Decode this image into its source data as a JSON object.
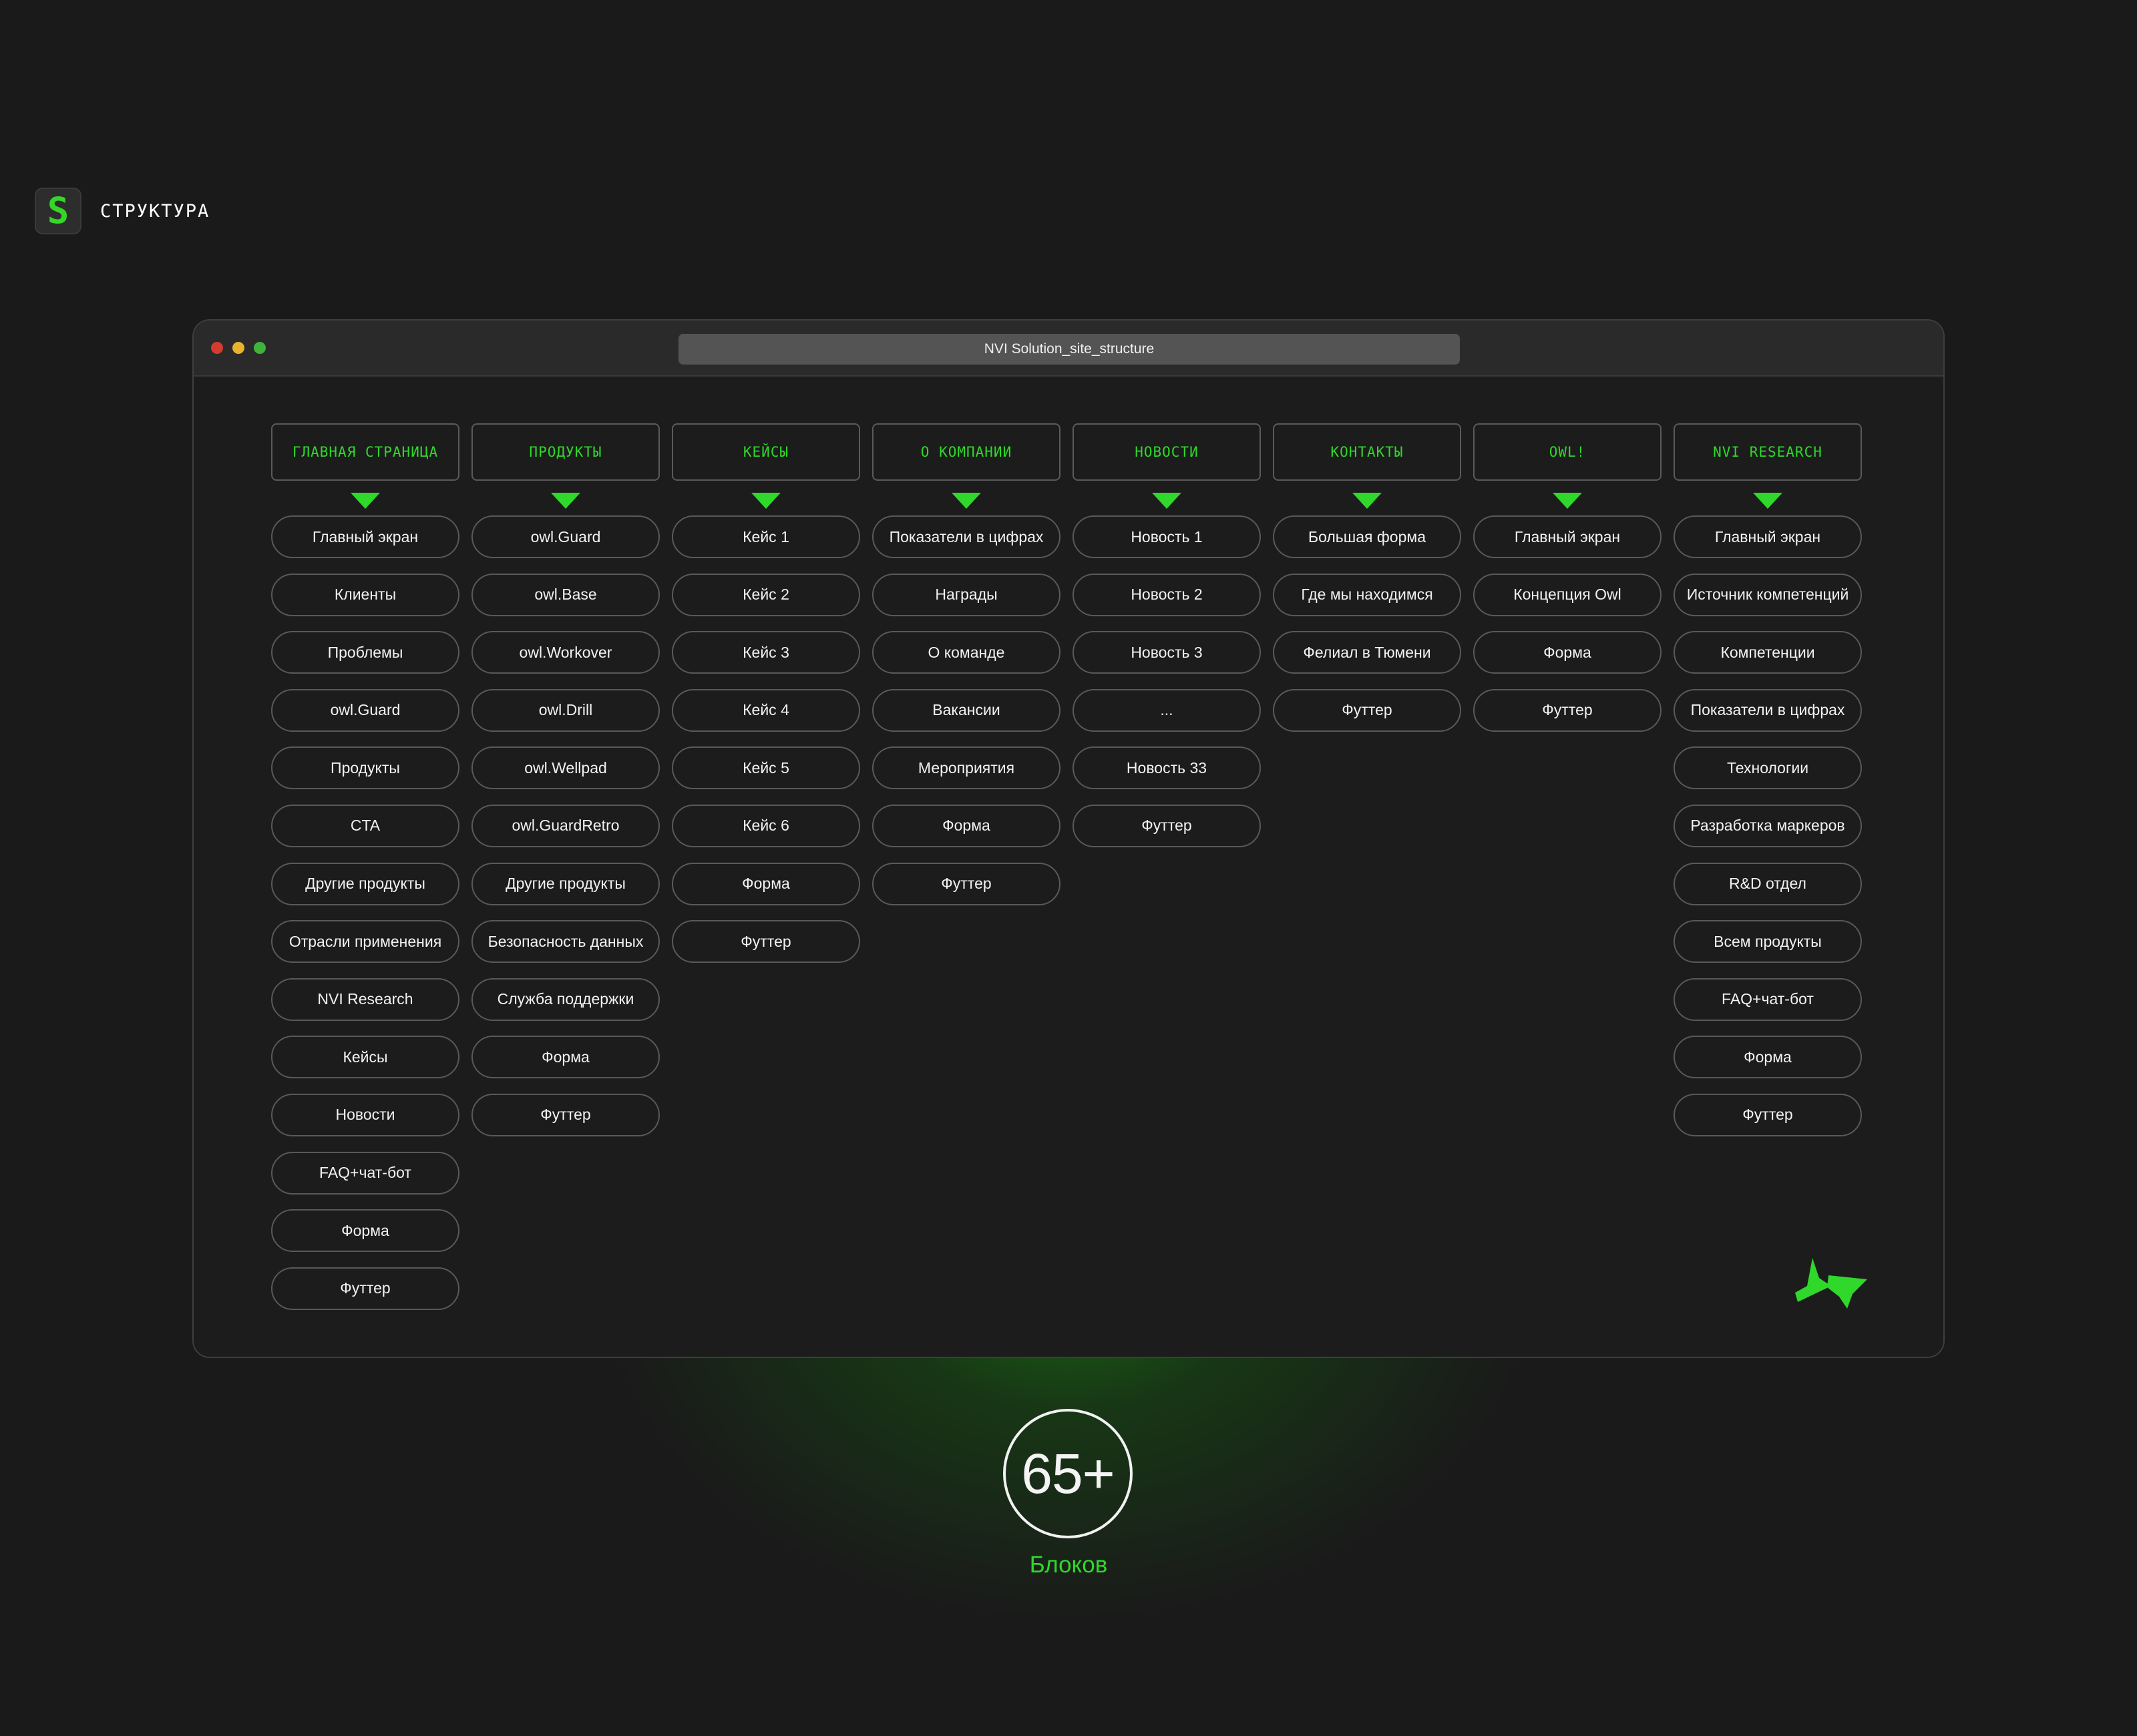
{
  "header": {
    "logo_letter": "S",
    "title": "СТРУКТУРА"
  },
  "window": {
    "address": "NVI Solution_site_structure"
  },
  "columns": [
    {
      "title": "ГЛАВНАЯ СТРАНИЦА",
      "items": [
        "Главный экран",
        "Клиенты",
        "Проблемы",
        "owl.Guard",
        "Продукты",
        "CTA",
        "Другие продукты",
        "Отрасли применения",
        "NVI Research",
        "Кейсы",
        "Новости",
        "FAQ+чат-бот",
        "Форма",
        "Футтер"
      ]
    },
    {
      "title": "ПРОДУКТЫ",
      "items": [
        "owl.Guard",
        "owl.Base",
        "owl.Workover",
        "owl.Drill",
        "owl.Wellpad",
        "owl.GuardRetro",
        "Другие продукты",
        "Безопасность данных",
        "Служба поддержки",
        "Форма",
        "Футтер"
      ]
    },
    {
      "title": "КЕЙСЫ",
      "items": [
        "Кейс 1",
        "Кейс 2",
        "Кейс 3",
        "Кейс 4",
        "Кейс 5",
        "Кейс 6",
        "Форма",
        "Футтер"
      ]
    },
    {
      "title": "О КОМПАНИИ",
      "items": [
        "Показатели в цифрах",
        "Награды",
        "О команде",
        "Вакансии",
        "Мероприятия",
        "Форма",
        "Футтер"
      ]
    },
    {
      "title": "НОВОСТИ",
      "items": [
        "Новость 1",
        "Новость 2",
        "Новость 3",
        "...",
        "Новость 33",
        "Футтер"
      ]
    },
    {
      "title": "КОНТАКТЫ",
      "items": [
        "Большая форма",
        "Где мы находимся",
        "Фелиал в Тюмени",
        "Футтер"
      ]
    },
    {
      "title": "OWL!",
      "items": [
        "Главный экран",
        "Концепция Owl",
        "Форма",
        "Футтер"
      ]
    },
    {
      "title": "NVI RESEARCH",
      "items": [
        "Главный экран",
        "Источник компетенций",
        "Компетенции",
        "Показатели в цифрах",
        "Технологии",
        "Разработка маркеров",
        "R&D отдел",
        "Всем продукты",
        "FAQ+чат-бот",
        "Форма",
        "Футтер"
      ]
    }
  ],
  "counter": {
    "value": "65+",
    "label": "Блоков"
  },
  "colors": {
    "accent": "#2fd82a",
    "background": "#1a1a1a",
    "pill_border": "#595959"
  }
}
